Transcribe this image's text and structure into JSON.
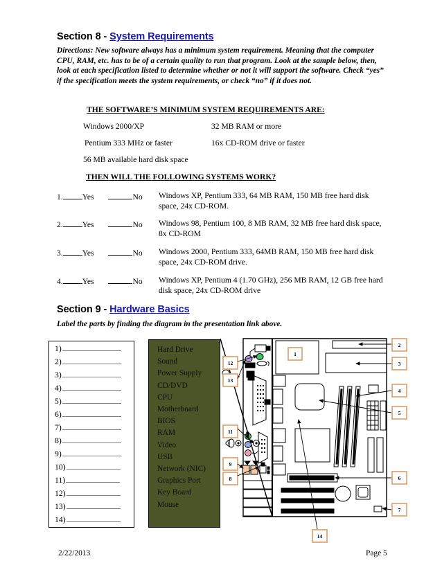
{
  "document": {
    "page_number_label": "Page 5",
    "date": "2/22/2013"
  },
  "section8": {
    "heading_prefix": "Section 8 - ",
    "heading_link": "System Requirements",
    "directions": "Directions:  New software always has a minimum system requirement.  Meaning that the computer CPU, RAM, etc. has to be of a certain quality to run that program.  Look at the sample below, then, look at each specification listed to determine whether or not it will support the software.  Check “yes” if the specification meets the system requirements, or check “no” if it does not.",
    "specs_heading": "THE SOFTWARE’S MINIMUM SYSTEM REQUIREMENTS ARE:",
    "specs": [
      {
        "left": "Windows 2000/XP",
        "right": "32 MB RAM or more"
      },
      {
        "left": "Pentium 333 MHz or faster",
        "right": "16x CD-ROM drive or faster"
      },
      {
        "left": "56 MB available hard disk space",
        "right": ""
      }
    ],
    "questions_heading": "THEN WILL THE FOLLOWING SYSTEMS WORK?",
    "yes_label": "Yes",
    "no_label": "No",
    "questions": [
      {
        "number": "1.",
        "text": "Windows XP, Pentium 333, 64 MB RAM, 150 MB free hard disk space, 24x CD-ROM."
      },
      {
        "number": "2.",
        "text": "Windows 98, Pentium 100, 8 MB RAM, 32 MB free hard disk space, 8x CD-ROM"
      },
      {
        "number": "3.",
        "text": "Windows 2000, Pentium 333, 64MB RAM, 150 MB free hard disk space, 24x CD-ROM drive."
      },
      {
        "number": "4.",
        "text": "Windows XP, Pentium 4 (1.70 GHz), 256 MB RAM, 12 GB free hard disk space, 24x CD-ROM drive"
      }
    ]
  },
  "section9": {
    "heading_prefix": "Section 9 - ",
    "heading_link": "Hardware Basics",
    "directions": "Label the parts by finding the diagram in the presentation link above.",
    "answer_blanks": [
      "1)",
      "2)",
      "3)",
      "4)",
      "5)",
      "6)",
      "7)",
      "8)",
      "9)",
      "10)",
      "11)",
      "12)",
      "13)",
      "14)"
    ],
    "word_bank": [
      "Hard Drive",
      "Sound",
      "Power Supply",
      "CD/DVD",
      "CPU",
      "Motherboard",
      "BIOS",
      "RAM",
      "Video",
      "USB",
      "Network (NIC)",
      "Graphics Port",
      "Key Board",
      "Mouse"
    ],
    "word_bank_color": "#4c5527",
    "callout_border_color": "#e0a878",
    "diagram_callouts": [
      "1",
      "2",
      "3",
      "4",
      "5",
      "6",
      "7",
      "8",
      "9",
      "11",
      "12",
      "13",
      "14"
    ]
  }
}
